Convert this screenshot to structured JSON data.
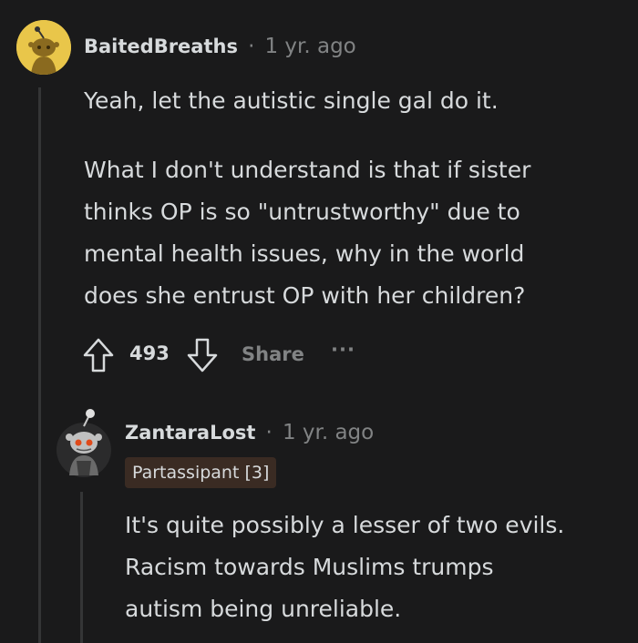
{
  "comment1": {
    "username": "BaitedBreaths",
    "separator": "·",
    "time": "1 yr. ago",
    "paragraph1": "Yeah, let the autistic single gal do it.",
    "paragraph2_lines": [
      "What I don't understand is that if sister",
      "thinks OP is so \"untrustworthy\" due to",
      "mental health issues, why in the world",
      "does she entrust OP with her children?"
    ],
    "actions": {
      "upvote_icon": "arrow-up-icon",
      "score": "493",
      "downvote_icon": "arrow-down-icon",
      "share_label": "Share",
      "more_label": "···"
    }
  },
  "comment2": {
    "username": "ZantaraLost",
    "separator": "·",
    "time": "1 yr. ago",
    "flair": "Partassipant [3]",
    "body_lines": [
      "It's quite possibly a lesser of two evils.",
      "Racism towards Muslims trumps",
      "autism being unreliable."
    ]
  },
  "colors": {
    "background": "#1a1a1b",
    "text": "#d7dadc",
    "muted": "#818384",
    "avatar1_bg": "#e9c64a",
    "flair_bg": "#3a2b23"
  }
}
